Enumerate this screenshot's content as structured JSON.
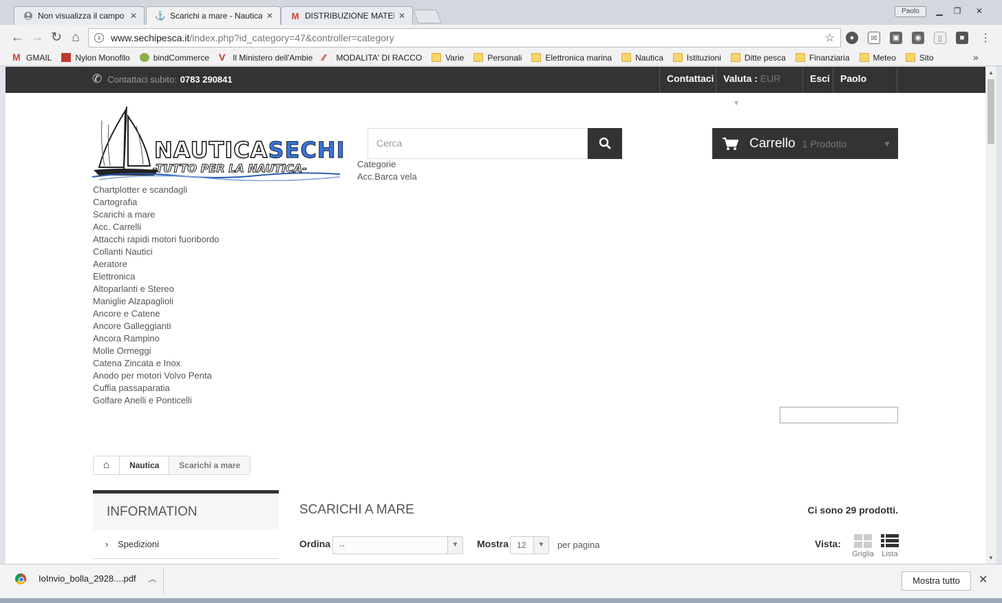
{
  "browser": {
    "tabs": [
      {
        "title": "Non visualizza il campo",
        "icon": "avatar-icon"
      },
      {
        "title": "Scarichi a mare - Nautica",
        "icon": "anchor-icon"
      },
      {
        "title": "DISTRIBUZIONE MATERIA",
        "icon": "gmail-icon"
      }
    ],
    "profile": "Paolo",
    "url_host": "www.sechipesca.it",
    "url_path": "/index.php?id_category=47&controller=category",
    "bookmarks": [
      {
        "label": "GMAIL",
        "icon": "gmail-icon"
      },
      {
        "label": "Nylon Monofilo",
        "icon": "site-icon"
      },
      {
        "label": "bindCommerce",
        "icon": "site-icon"
      },
      {
        "label": "Il Ministero dell'Ambie",
        "icon": "site-icon"
      },
      {
        "label": "MODALITA' DI RACCO",
        "icon": "site-icon"
      },
      {
        "label": "Varie",
        "icon": "folder-icon"
      },
      {
        "label": "Personali",
        "icon": "folder-icon"
      },
      {
        "label": "Elettronica marina",
        "icon": "folder-icon"
      },
      {
        "label": "Nautica",
        "icon": "folder-icon"
      },
      {
        "label": "Istituzioni",
        "icon": "folder-icon"
      },
      {
        "label": "Ditte pesca",
        "icon": "folder-icon"
      },
      {
        "label": "Finanziaria",
        "icon": "folder-icon"
      },
      {
        "label": "Meteo",
        "icon": "folder-icon"
      },
      {
        "label": "Sito",
        "icon": "folder-icon"
      }
    ],
    "bookmarks_more": "»"
  },
  "header": {
    "contact_label": "Contattaci subito:",
    "phone": "0783 290841",
    "nav": {
      "contact": "Contattaci",
      "currency_label": "Valuta :",
      "currency_value": "EUR",
      "logout": "Esci",
      "user": "Paolo Sechi"
    },
    "logo_text_1": "NAUTICA",
    "logo_text_2": "SECHI",
    "logo_tagline": "-TUTTO PER LA NAUTICA-",
    "search_placeholder": "Cerca",
    "cart": {
      "label": "Carrello",
      "quantity": "1 Prodotto"
    }
  },
  "categories_block": {
    "title": "Categorie",
    "item": "Acc.Barca vela"
  },
  "category_list": [
    "Chartplotter e scandagli",
    "Cartografia",
    "Scarichi a mare",
    "Acc. Carrelli",
    "Attacchi rapidi motori fuoribordo",
    "Collanti Nautici",
    "Aeratore",
    "Elettronica",
    "Altoparlanti e Stereo",
    "Maniglie Alzapaglioli",
    "Ancore e Catene",
    "Ancore Galleggianti",
    "Ancora Rampino",
    "Molle Ormeggi",
    "Catena Zincata e Inox",
    "Anodo per motori Volvo Penta",
    "Cuffia passaparatia",
    "Golfare Anelli e Ponticelli"
  ],
  "breadcrumb": {
    "level1": "Nautica",
    "level2": "Scarichi a mare"
  },
  "sidebar": {
    "title": "INFORMATION",
    "items": [
      "Spedizioni"
    ]
  },
  "content": {
    "title": "SCARICHI A MARE",
    "count": "Ci sono 29 prodotti.",
    "sort_label": "Ordina",
    "sort_value": "--",
    "show_label": "Mostra",
    "show_value": "12",
    "per_page": "per pagina",
    "view_label": "Vista:",
    "view_grid": "Griglia",
    "view_list": "Lista"
  },
  "downloads": {
    "file": "IoInvio_bolla_2928....pdf",
    "show_all": "Mostra tutto"
  }
}
